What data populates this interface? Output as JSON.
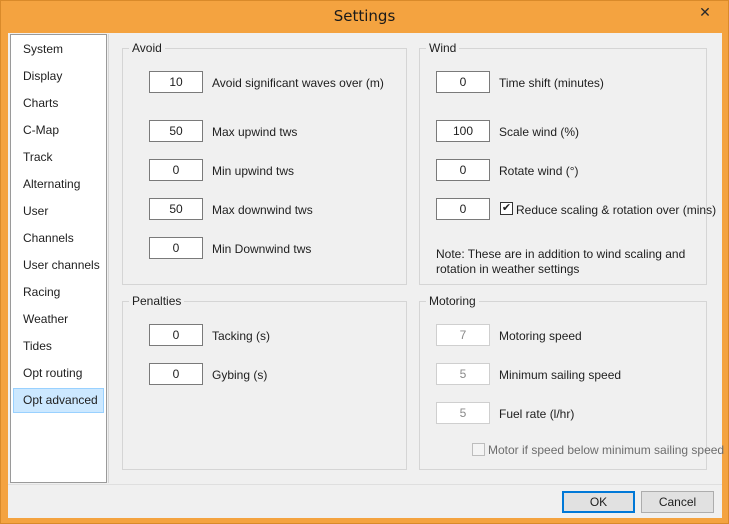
{
  "window": {
    "title": "Settings",
    "close_glyph": "✕"
  },
  "nav": {
    "items": [
      {
        "label": "System"
      },
      {
        "label": "Display"
      },
      {
        "label": "Charts"
      },
      {
        "label": "C-Map"
      },
      {
        "label": "Track"
      },
      {
        "label": "Alternating"
      },
      {
        "label": "User"
      },
      {
        "label": "Channels"
      },
      {
        "label": "User channels"
      },
      {
        "label": "Racing"
      },
      {
        "label": "Weather"
      },
      {
        "label": "Tides"
      },
      {
        "label": "Opt routing"
      },
      {
        "label": "Opt advanced"
      }
    ],
    "selected": "Opt advanced"
  },
  "avoid": {
    "title": "Avoid",
    "rows": [
      {
        "value": "10",
        "label": "Avoid significant waves over (m)"
      },
      {
        "value": "50",
        "label": "Max upwind tws"
      },
      {
        "value": "0",
        "label": "Min upwind tws"
      },
      {
        "value": "50",
        "label": "Max downwind tws"
      },
      {
        "value": "0",
        "label": "Min Downwind tws"
      }
    ]
  },
  "wind": {
    "title": "Wind",
    "rows": [
      {
        "value": "0",
        "label": "Time shift (minutes)"
      },
      {
        "value": "100",
        "label": "Scale wind (%)"
      },
      {
        "value": "0",
        "label": "Rotate wind (°)"
      },
      {
        "value": "0",
        "label": "Reduce scaling & rotation over (mins)"
      }
    ],
    "reduce_checked": true,
    "note": "Note: These are in addition to wind scaling and rotation in weather settings"
  },
  "penalties": {
    "title": "Penalties",
    "rows": [
      {
        "value": "0",
        "label": "Tacking (s)"
      },
      {
        "value": "0",
        "label": "Gybing (s)"
      }
    ]
  },
  "motoring": {
    "title": "Motoring",
    "rows": [
      {
        "value": "7",
        "label": "Motoring speed"
      },
      {
        "value": "5",
        "label": "Minimum sailing speed"
      },
      {
        "value": "5",
        "label": "Fuel rate (l/hr)"
      }
    ],
    "motor_checkbox_label": "Motor if speed below minimum sailing speed",
    "motor_checked": false
  },
  "buttons": {
    "ok": "OK",
    "cancel": "Cancel"
  }
}
